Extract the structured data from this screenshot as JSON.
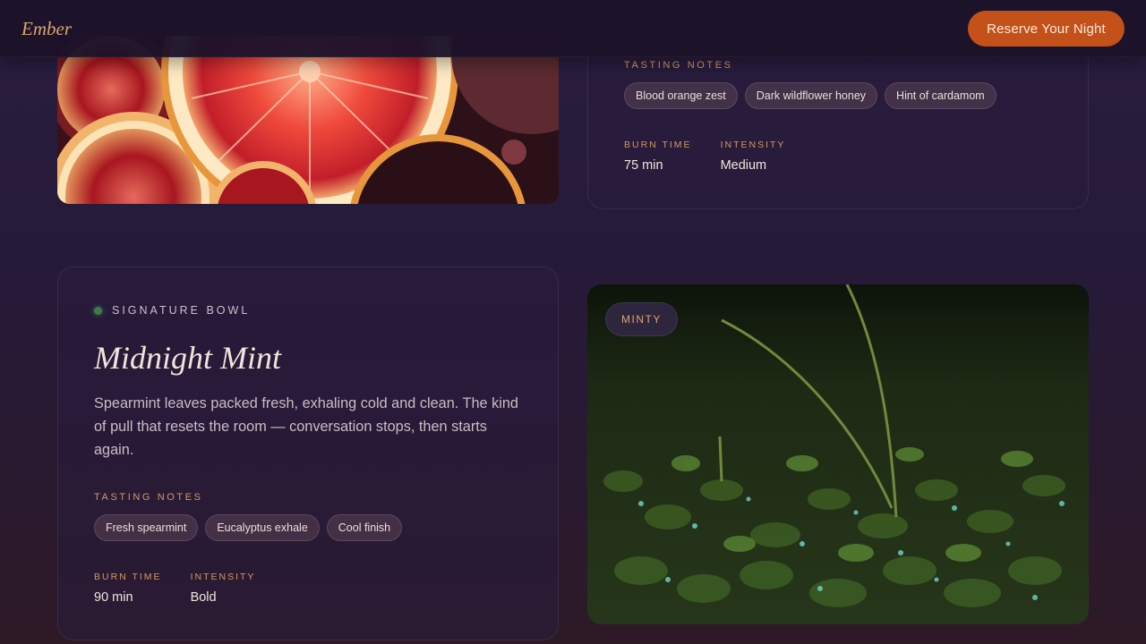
{
  "header": {
    "logo": "Ember",
    "reserve_label": "Reserve Your Night"
  },
  "card_top": {
    "tasting_label": "TASTING NOTES",
    "notes": [
      "Blood orange zest",
      "Dark wildflower honey",
      "Hint of cardamom"
    ],
    "burn_label": "BURN TIME",
    "burn_value": "75 min",
    "intensity_label": "INTENSITY",
    "intensity_value": "Medium"
  },
  "card_mint": {
    "kicker": "SIGNATURE BOWL",
    "title": "Midnight Mint",
    "description": "Spearmint leaves packed fresh, exhaling cold and clean. The kind of pull that resets the room — conversation stops, then starts again.",
    "tasting_label": "TASTING NOTES",
    "notes": [
      "Fresh spearmint",
      "Eucalyptus exhale",
      "Cool finish"
    ],
    "burn_label": "BURN TIME",
    "burn_value": "90 min",
    "intensity_label": "INTENSITY",
    "intensity_value": "Bold",
    "image_badge": "MINTY"
  },
  "colors": {
    "accent": "#c4501a",
    "gold": "#d39a5c",
    "status_dot": "#3d7a4e"
  }
}
